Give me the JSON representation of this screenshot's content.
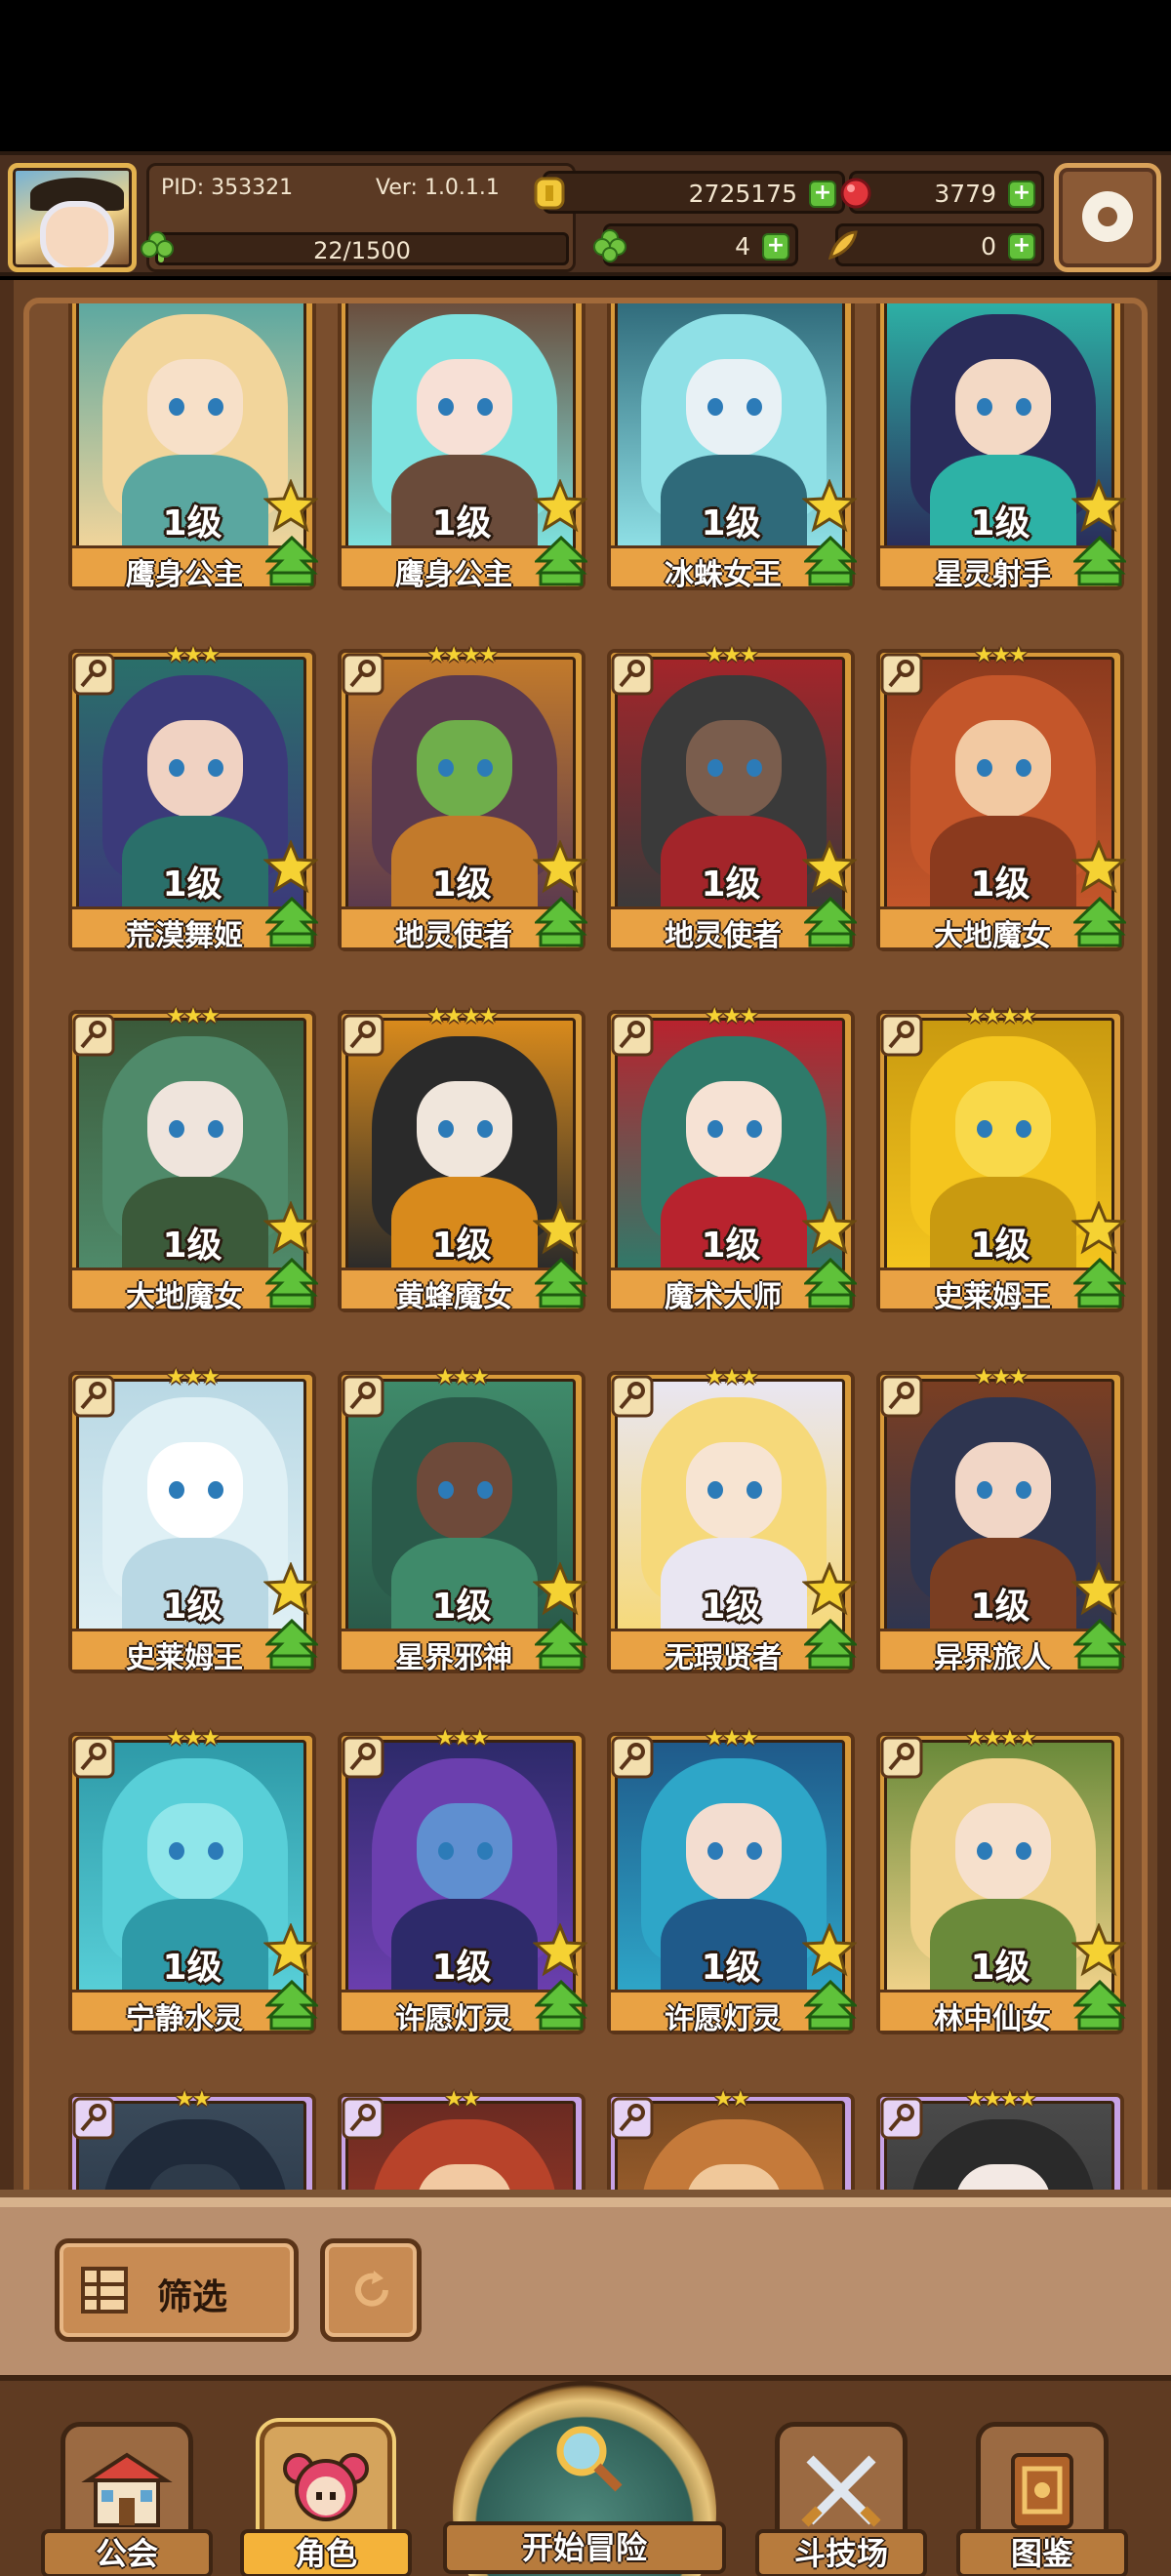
{
  "header": {
    "pid": "PID: 353321",
    "version": "Ver: 1.0.1.1",
    "experience_text": "22/1500",
    "experience_progress": 0.0147,
    "gold": "2725175",
    "gems": "3779",
    "clovers": "4",
    "feathers": "0"
  },
  "characters": [
    {
      "level": "1级",
      "name": "鹰身公主",
      "rank_stars": "",
      "frame": "gold",
      "palette": [
        "#f2d59b",
        "#f7e0c8",
        "#5aa7a0"
      ]
    },
    {
      "level": "1级",
      "name": "鹰身公主",
      "rank_stars": "",
      "frame": "gold",
      "palette": [
        "#7ee3e0",
        "#f7e0d6",
        "#6a4b3a"
      ]
    },
    {
      "level": "1级",
      "name": "冰蛛女王",
      "rank_stars": "",
      "frame": "gold",
      "palette": [
        "#8fe0e6",
        "#e8f1f5",
        "#2f6a7a"
      ]
    },
    {
      "level": "1级",
      "name": "星灵射手",
      "rank_stars": "",
      "frame": "gold",
      "palette": [
        "#2a2c5a",
        "#f3d9c5",
        "#2db2a6"
      ]
    },
    {
      "level": "1级",
      "name": "荒漠舞姬",
      "rank_stars": "★★★",
      "frame": "gold",
      "palette": [
        "#3b3a7a",
        "#f0d2c2",
        "#2a6f6a"
      ]
    },
    {
      "level": "1级",
      "name": "地灵使者",
      "rank_stars": "★★★★",
      "frame": "gold",
      "palette": [
        "#5b3a4e",
        "#6fae4b",
        "#c27a2b"
      ]
    },
    {
      "level": "1级",
      "name": "地灵使者",
      "rank_stars": "★★★",
      "frame": "gold",
      "palette": [
        "#3a3a3a",
        "#7a5d4d",
        "#a3252a"
      ]
    },
    {
      "level": "1级",
      "name": "大地魔女",
      "rank_stars": "★★★",
      "frame": "gold",
      "palette": [
        "#c4562a",
        "#f2c9a2",
        "#8b3a1e"
      ]
    },
    {
      "level": "1级",
      "name": "大地魔女",
      "rank_stars": "★★★",
      "frame": "gold",
      "palette": [
        "#4f8a6a",
        "#efe4dc",
        "#3b5a3a"
      ]
    },
    {
      "level": "1级",
      "name": "黄蜂魔女",
      "rank_stars": "★★★★",
      "frame": "gold",
      "palette": [
        "#2a2a2a",
        "#f0e6dc",
        "#d88a1c"
      ]
    },
    {
      "level": "1级",
      "name": "魔术大师",
      "rank_stars": "★★★",
      "frame": "gold",
      "palette": [
        "#2f7a6a",
        "#f6e2d4",
        "#b8232e"
      ]
    },
    {
      "level": "1级",
      "name": "史莱姆王",
      "rank_stars": "★★★★",
      "frame": "gold",
      "palette": [
        "#f4c51e",
        "#f9d94a",
        "#c99a10"
      ]
    },
    {
      "level": "1级",
      "name": "史莱姆王",
      "rank_stars": "★★★",
      "frame": "gold",
      "palette": [
        "#dff0f5",
        "#ffffff",
        "#b9d8e4"
      ]
    },
    {
      "level": "1级",
      "name": "星界邪神",
      "rank_stars": "★★★",
      "frame": "gold",
      "palette": [
        "#2a5a4a",
        "#6e4a3a",
        "#3f8a6a"
      ]
    },
    {
      "level": "1级",
      "name": "无瑕贤者",
      "rank_stars": "★★★",
      "frame": "gold",
      "palette": [
        "#f6d97a",
        "#f7e4d2",
        "#e9e6f2"
      ]
    },
    {
      "level": "1级",
      "name": "异界旅人",
      "rank_stars": "★★★",
      "frame": "gold",
      "palette": [
        "#2e3550",
        "#f1d6c6",
        "#7a3e22"
      ]
    },
    {
      "level": "1级",
      "name": "宁静水灵",
      "rank_stars": "★★★",
      "frame": "gold",
      "palette": [
        "#58cfd8",
        "#8fe6ea",
        "#2e9aa8"
      ]
    },
    {
      "level": "1级",
      "name": "许愿灯灵",
      "rank_stars": "★★★",
      "frame": "gold",
      "palette": [
        "#6b3fae",
        "#5f8fd0",
        "#2d2a6a"
      ]
    },
    {
      "level": "1级",
      "name": "许愿灯灵",
      "rank_stars": "★★★",
      "frame": "gold",
      "palette": [
        "#2ea6c8",
        "#f3ddd0",
        "#1f5a8a"
      ]
    },
    {
      "level": "1级",
      "name": "林中仙女",
      "rank_stars": "★★★★",
      "frame": "gold",
      "palette": [
        "#f0d28a",
        "#f6e0cc",
        "#6a8a3a"
      ]
    },
    {
      "level": "",
      "name": "",
      "rank_stars": "★★",
      "frame": "purple",
      "palette": [
        "#1f2a3a",
        "#2e3b4a",
        "#3a4a5a"
      ]
    },
    {
      "level": "",
      "name": "",
      "rank_stars": "★★",
      "frame": "purple",
      "palette": [
        "#b8432a",
        "#f2c9a2",
        "#6a2a22"
      ]
    },
    {
      "level": "",
      "name": "",
      "rank_stars": "★★",
      "frame": "purple",
      "palette": [
        "#c57a3a",
        "#f0c89a",
        "#7a4a22"
      ]
    },
    {
      "level": "",
      "name": "",
      "rank_stars": "★★★★",
      "frame": "purple",
      "palette": [
        "#2a2a2a",
        "#f3e9e4",
        "#4a4a4a"
      ]
    }
  ],
  "filter": {
    "label": "筛选"
  },
  "nav": {
    "guild": "公会",
    "character": "角色",
    "adventure": "开始冒险",
    "arena": "斗技场",
    "codex": "图鉴"
  },
  "colors": {
    "accent": "#e9a244",
    "frame_gold": "#d89a3a",
    "frame_purple": "#c7a2e6",
    "panel": "#6a4326"
  }
}
